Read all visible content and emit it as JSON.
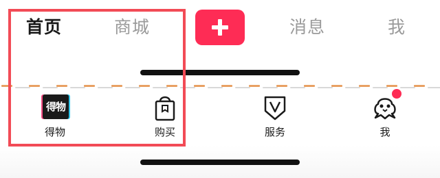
{
  "top_tabs": {
    "home": "首页",
    "mall": "商城",
    "messages": "消息",
    "me": "我"
  },
  "add_button": {
    "icon": "plus-icon",
    "color": "#fe2c55"
  },
  "bottom_nav": {
    "items": [
      {
        "label": "得物",
        "icon": "dewu-app-icon",
        "icon_text": "得物"
      },
      {
        "label": "购买",
        "icon": "shopping-bag-icon"
      },
      {
        "label": "服务",
        "icon": "shield-v-icon"
      },
      {
        "label": "我",
        "icon": "mascot-icon",
        "has_badge": true
      }
    ]
  },
  "colors": {
    "accent": "#fe2c55",
    "highlight_border": "#f24b56",
    "dash": "#e8a062"
  }
}
